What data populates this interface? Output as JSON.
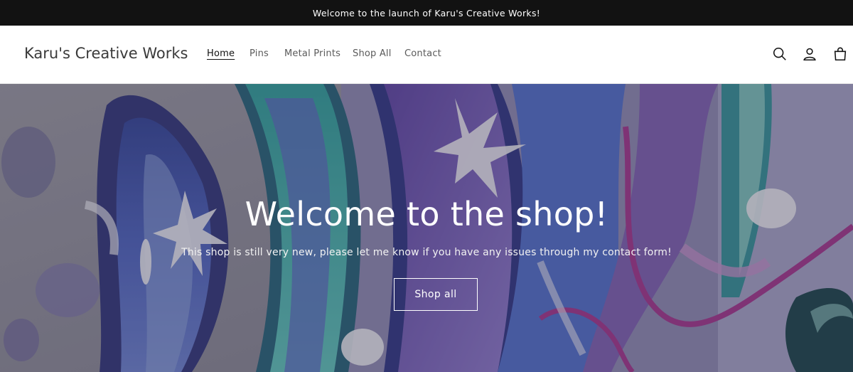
{
  "announcement": {
    "text": "Welcome to the launch of Karu's Creative Works!"
  },
  "header": {
    "logo": "Karu's Creative Works",
    "nav": [
      {
        "label": "Home",
        "active": true
      },
      {
        "label": "Pins",
        "active": false
      },
      {
        "label": "Metal Prints",
        "active": false
      },
      {
        "label": "Shop All",
        "active": false
      },
      {
        "label": "Contact",
        "active": false
      }
    ],
    "icons": [
      "search-icon",
      "account-icon",
      "cart-icon"
    ]
  },
  "hero": {
    "title": "Welcome to the shop!",
    "subtitle": "This shop is still very new, please let me know if you have any issues through my contact form!",
    "button_label": "Shop all"
  },
  "colors": {
    "announcement_bg": "#121212",
    "header_bg": "#ffffff",
    "hero_overlay": "#3c3c46",
    "art_blue": "#3b4fb0",
    "art_purple": "#6e4fb8",
    "art_teal": "#2fa9a6",
    "art_magenta": "#b0389c"
  }
}
